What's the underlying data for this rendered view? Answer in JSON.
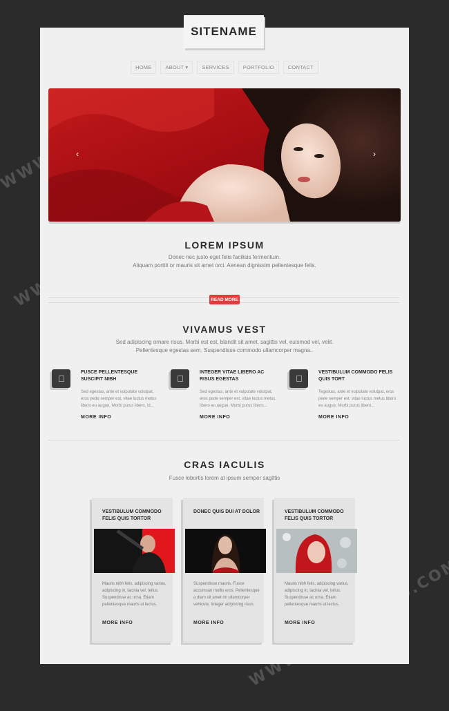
{
  "site": {
    "name": "SITENAME"
  },
  "nav": {
    "items": [
      {
        "label": "HOME"
      },
      {
        "label": "ABOUT ▾"
      },
      {
        "label": "SERVICES"
      },
      {
        "label": "PORTFOLIO"
      },
      {
        "label": "CONTACT"
      }
    ]
  },
  "hero": {
    "prev_glyph": "‹",
    "next_glyph": "›"
  },
  "intro": {
    "title": "LOREM IPSUM",
    "line1": "Donec nec justo eget felis facilisis fermentum.",
    "line2": "Aliquam porttit or mauris sit amet orci. Aenean dignissim pellentesque felis.",
    "button": "READ MORE"
  },
  "vivamus": {
    "title": "VIVAMUS VEST",
    "line1": "Sed adipiscing ornare risus. Morbi est est, blandit sit amet, sagittis vel, euismod vel, velit.",
    "line2": "Pellentesque egestas sem. Suspendisse commodo ullamcorper magna..",
    "features": [
      {
        "title": "FUSCE PELLENTESQUE SUSCIPIT NIBH",
        "text": "Sed egestas, ante et vulputate volutpat, eros pede semper est, vitae luctus metus libero eu augue. Morbi purus libero, id...",
        "more": "MORE INFO"
      },
      {
        "title": "INTEGER VITAE LIBERO AC RISUS EGESTAS",
        "text": "Sed egestas, ante et vulputate volutpat, eros pede semper est, vitae luctus metus libero eu augue. Morbi purus libero...",
        "more": "MORE INFO"
      },
      {
        "title": "VESTIBULUM COMMODO FELIS QUIS TORT",
        "text": "Tegestas, ante et vulputate volutpat, eros pede semper est, vitae luctus metus libero eu augue. Morbi purus libero...",
        "more": "MORE INFO"
      }
    ]
  },
  "cras": {
    "title": "CRAS IACULIS",
    "subtitle": "Fusce lobortis lorem at ipsum semper sagittis",
    "cards": [
      {
        "title": "VESTIBULUM COMMODO FELIS QUIS TORTOR",
        "text": "Mauris nibh felis, adipiscing varius, adipiscing in, lacinia vel, tellus. Suspendisse ac urna. Etiam pellentesque mauris ut lectus.",
        "more": "MORE INFO"
      },
      {
        "title": "DONEC QUIS DUI AT DOLOR",
        "text": "Suspendisse mauris. Fusce accumsan mollis eros. Pellentesque a diam sit amet mi ullamcorper vehicula. Integer adipiscing risus.",
        "more": "MORE INFO"
      },
      {
        "title": "VESTIBULUM COMMODO FELIS QUIS TORTOR",
        "text": "Mauris nibh felis, adipiscing varius, adipiscing in, lacinia vel, tellus. Suspendisse ac urna. Etiam pellentesque mauris ut lectus.",
        "more": "MORE INFO"
      }
    ]
  },
  "watermark": {
    "text": "WWW.DOWNDEMO.COM"
  },
  "colors": {
    "accent": "#e03c3c",
    "background": "#2b2b2b",
    "page": "#f0f0f0"
  }
}
